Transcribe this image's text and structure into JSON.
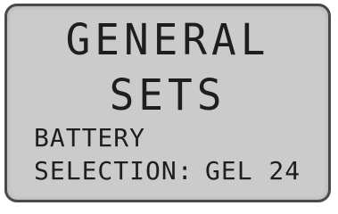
{
  "screen": {
    "title_line1": "GENERAL",
    "title_line2": "SETS",
    "battery_label": "BATTERY",
    "selection_label": "SELECTION:",
    "selection_value": "GEL 24"
  },
  "colors": {
    "lcd_background": "#cbcbcb",
    "lcd_text": "#1e1e1e",
    "bezel": "#4a4a4a"
  }
}
